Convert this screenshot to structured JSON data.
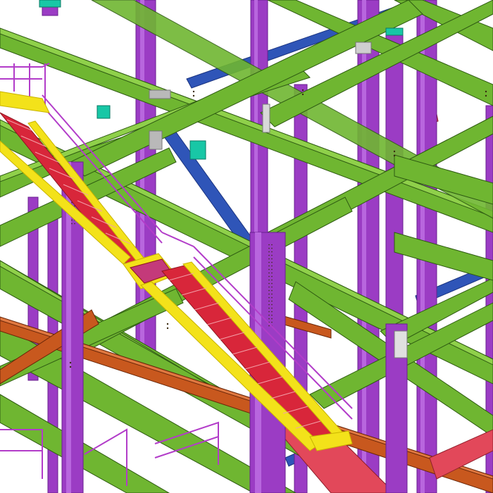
{
  "palette": {
    "background": "#ffffff",
    "beam_green": "#6fb631",
    "beam_green_dark": "#3f7a1a",
    "beam_green_light": "#8fd04a",
    "column_purple": "#9b3cc4",
    "column_purple_dark": "#6a1f8f",
    "column_purple_light": "#b866de",
    "brace_blue": "#2f55b8",
    "brace_blue_dark": "#1b3480",
    "stair_yellow": "#f3e21a",
    "stair_yellow_dark": "#c9b400",
    "tread_red": "#d8263a",
    "rail_magenta": "#b23cc9",
    "beam_orange": "#c8581e",
    "beam_orange_dark": "#8f3810",
    "beam_red": "#e2485a",
    "plate_teal": "#18c7a6",
    "plate_gray": "#b9b9b9",
    "edge": "#1e2b12"
  },
  "icons": {
    "scene": "steel-structure-3d-model"
  }
}
